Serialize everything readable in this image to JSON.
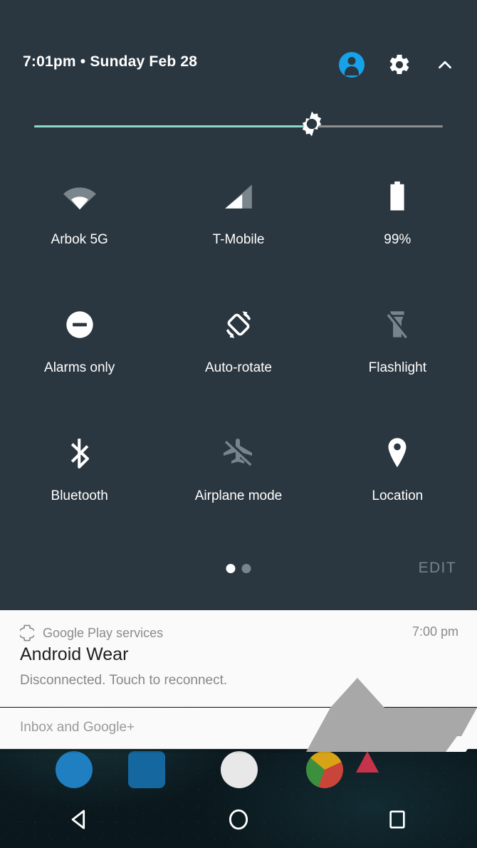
{
  "status_header": {
    "datetime": "7:01pm • Sunday Feb 28",
    "avatar_icon": "user-avatar-icon",
    "settings_icon": "gear-icon",
    "collapse_icon": "chevron-up-icon",
    "avatar_color": "#15a2e8"
  },
  "brightness": {
    "label": "brightness-slider",
    "icon": "brightness-sun-icon",
    "value_percent": 68,
    "fill_color": "#8fd9c8",
    "track_color": "#8e8e8e"
  },
  "tiles": [
    [
      {
        "label": "Arbok 5G",
        "icon": "wifi-icon",
        "state": "on"
      },
      {
        "label": "T-Mobile",
        "icon": "cell-signal-icon",
        "state": "on"
      },
      {
        "label": "99%",
        "icon": "battery-icon",
        "state": "on"
      }
    ],
    [
      {
        "label": "Alarms only",
        "icon": "do-not-disturb-icon",
        "state": "on"
      },
      {
        "label": "Auto-rotate",
        "icon": "auto-rotate-icon",
        "state": "on"
      },
      {
        "label": "Flashlight",
        "icon": "flashlight-off-icon",
        "state": "off"
      }
    ],
    [
      {
        "label": "Bluetooth",
        "icon": "bluetooth-icon",
        "state": "on"
      },
      {
        "label": "Airplane mode",
        "icon": "airplane-off-icon",
        "state": "off"
      },
      {
        "label": "Location",
        "icon": "location-pin-icon",
        "state": "on"
      }
    ]
  ],
  "footer": {
    "edit_label": "EDIT",
    "pages": 2,
    "active_page": 1
  },
  "notifications": {
    "primary": {
      "app_name": "Google Play services",
      "app_icon": "watch-icon",
      "time": "7:00 pm",
      "title": "Android Wear",
      "body": "Disconnected. Touch to reconnect."
    },
    "grouped": {
      "label": "Inbox and Google+"
    }
  },
  "navbar": {
    "back_label": "back-button",
    "home_label": "home-button",
    "recents_label": "recents-button"
  },
  "colors": {
    "panel_bg": "#2b3740",
    "notification_bg": "#fafafa",
    "icon_on": "#ffffff",
    "icon_off": "#79838b"
  }
}
